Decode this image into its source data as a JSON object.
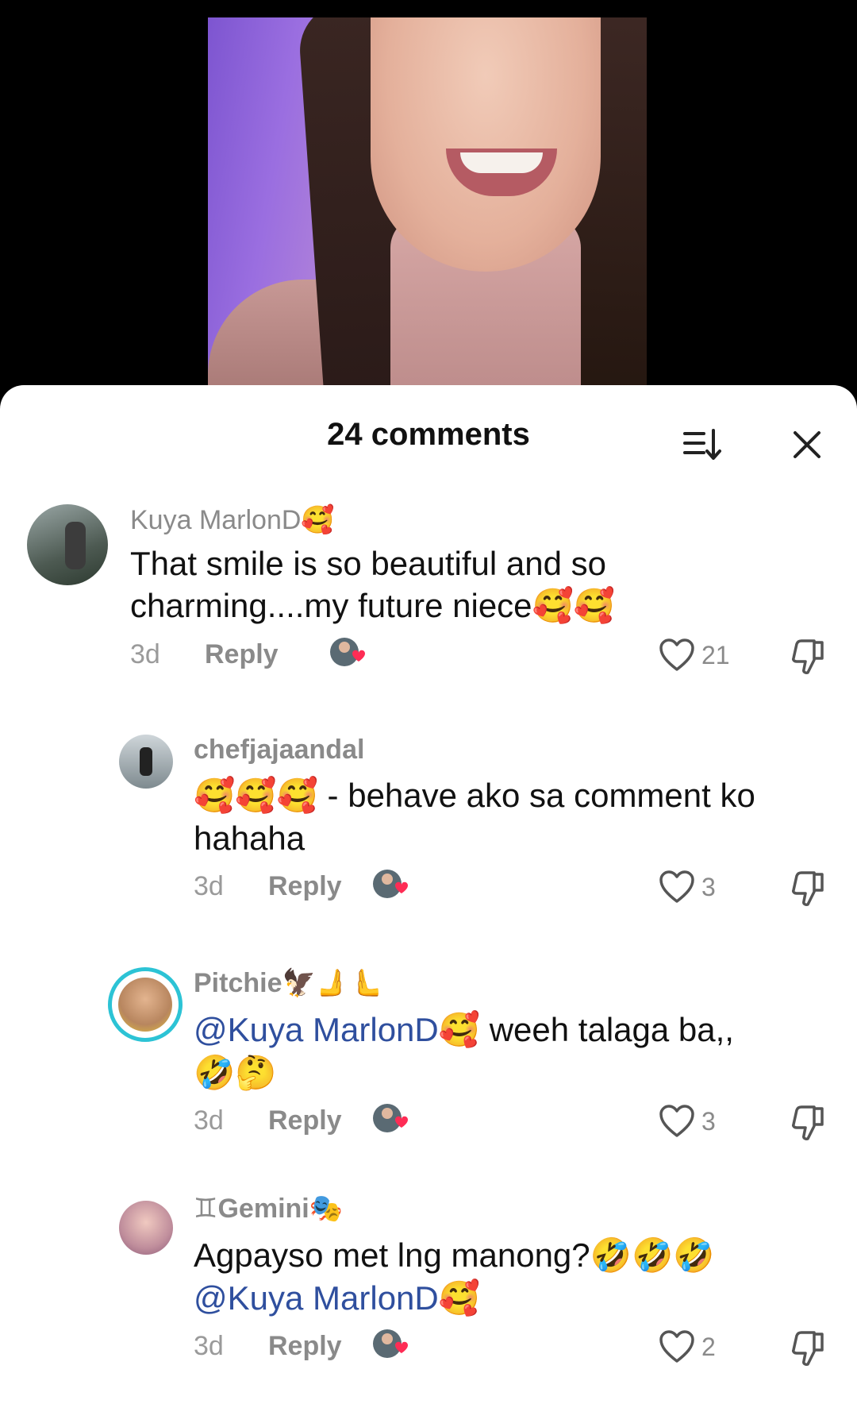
{
  "sheet": {
    "title": "24 comments",
    "sort_icon": "sort-icon",
    "close_icon": "close-icon"
  },
  "comments": [
    {
      "username": "Kuya MarlonD🥰",
      "line1": "That smile is so beautiful and so",
      "line2": "charming....my future niece🥰🥰",
      "age": "3d",
      "reply": "Reply",
      "likes": "21"
    },
    {
      "username": "chefjajaandal",
      "line1": "🥰🥰🥰 - behave ako sa comment ko",
      "line2": "hahaha",
      "age": "3d",
      "reply": "Reply",
      "likes": "3"
    },
    {
      "username": "Pitchie🦅🫸🫷",
      "mention": "@Kuya MarlonD🥰",
      "line1_rest": " weeh talaga ba,,",
      "line2": "🤣🤔",
      "age": "3d",
      "reply": "Reply",
      "likes": "3"
    },
    {
      "username": "♊Gemini🎭",
      "line1": "Agpayso met lng manong?🤣🤣🤣",
      "mention": "@Kuya MarlonD🥰",
      "age": "3d",
      "reply": "Reply",
      "likes": "2"
    }
  ],
  "colors": {
    "accent_mention": "#2f4f9e",
    "creator_heart": "#fe2c55",
    "muted_text": "#8a8a8a"
  }
}
